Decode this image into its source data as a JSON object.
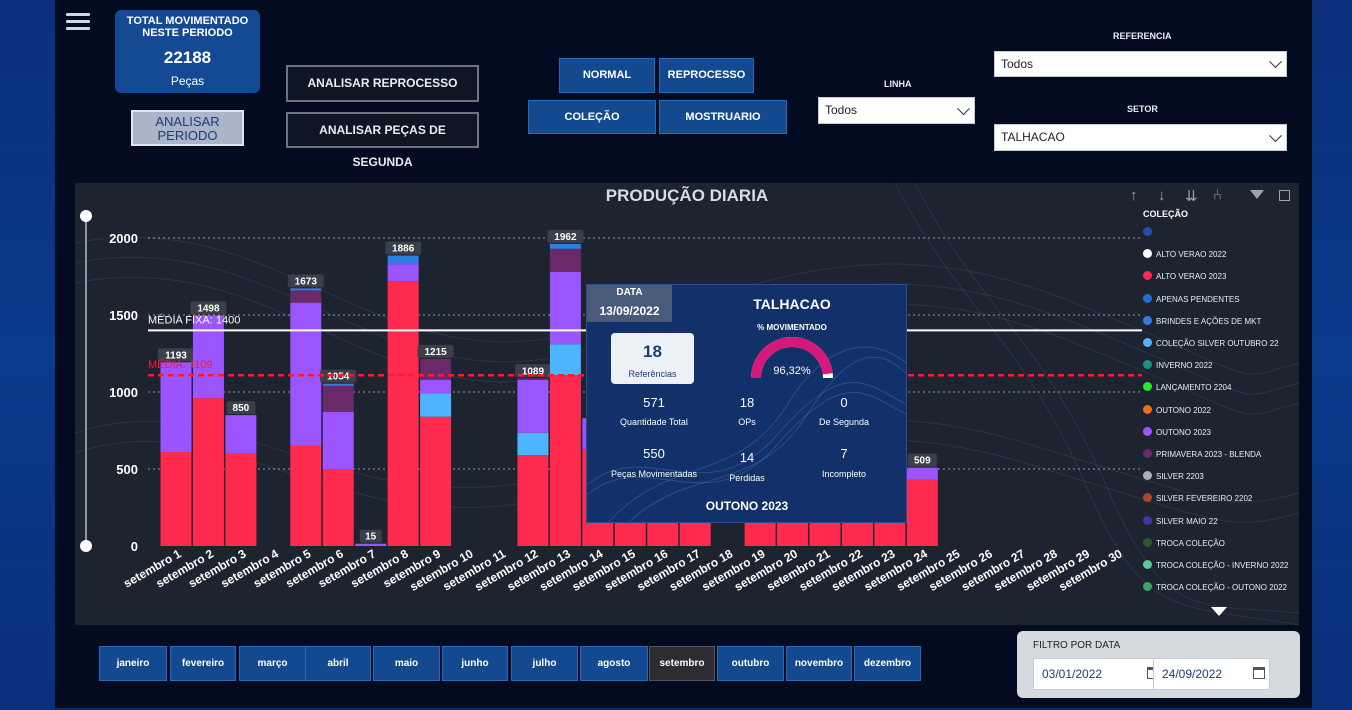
{
  "kpi": {
    "title": "TOTAL MOVIMENTADO NESTE PERIODO",
    "value": "22188",
    "unit": "Peças"
  },
  "buttons": {
    "analisar_periodo": "ANALISAR PERIODO",
    "analisar_reprocesso": "ANALISAR REPROCESSO",
    "analisar_segunda": "ANALISAR PEÇAS DE SEGUNDA",
    "normal": "NORMAL",
    "reprocesso": "REPROCESSO",
    "colecao": "COLEÇÃO",
    "mostruario": "MOSTRUARIO"
  },
  "filters": {
    "linha_label": "LINHA",
    "linha_value": "Todos",
    "referencia_label": "REFERENCIA",
    "referencia_value": "Todos",
    "setor_label": "SETOR",
    "setor_value": "TALHACAO"
  },
  "chart_title": "PRODUÇÃO DIARIA",
  "legend": {
    "title": "COLEÇÃO",
    "items": [
      {
        "label": "",
        "color": "#1f4fa8"
      },
      {
        "label": "ALTO VERAO 2022",
        "color": "#ffffff"
      },
      {
        "label": "ALTO VERAO 2023",
        "color": "#ff2a4d"
      },
      {
        "label": "APENAS PENDENTES",
        "color": "#1e6fd9"
      },
      {
        "label": "BRINDES E AÇÕES DE MKT",
        "color": "#2f7fe0"
      },
      {
        "label": "COLEÇÃO SILVER OUTUBRO 22",
        "color": "#4db5ff"
      },
      {
        "label": "INVERNO 2022",
        "color": "#1f8f80"
      },
      {
        "label": "LANÇAMENTO 2204",
        "color": "#29e82a"
      },
      {
        "label": "OUTONO 2022",
        "color": "#e8701e"
      },
      {
        "label": "OUTONO 2023",
        "color": "#9a55ff"
      },
      {
        "label": "PRIMAVERA 2023 - BLENDA",
        "color": "#6a2a6a"
      },
      {
        "label": "SILVER 2203",
        "color": "#a8b0bb"
      },
      {
        "label": "SILVER FEVEREIRO 2202",
        "color": "#b0452a"
      },
      {
        "label": "SILVER MAIO 22",
        "color": "#3a3aa0"
      },
      {
        "label": "TROCA COLEÇÃO",
        "color": "#2a5a2a"
      },
      {
        "label": "TROCA COLEÇÃO - INVERNO 2022",
        "color": "#5ac8a0"
      },
      {
        "label": "TROCA COLEÇÃO - OUTONO 2022",
        "color": "#3aa85a"
      }
    ]
  },
  "tooltip": {
    "data_label": "DATA",
    "date": "13/09/2022",
    "setor": "TALHACAO",
    "pct_label": "% MOVIMENTADO",
    "pct_value": "96,32%",
    "pct": 96.32,
    "ref_value": "18",
    "ref_label": "Referências",
    "qt_value": "571",
    "qt_label": "Quantidade Total",
    "ops_value": "18",
    "ops_label": "OPs",
    "seg_value": "0",
    "seg_label": "De Segunda",
    "mov_value": "550",
    "mov_label": "Peças Movimentadas",
    "perd_value": "14",
    "perd_label": "Perdidas",
    "inc_value": "7",
    "inc_label": "Incompleto",
    "colecao": "OUTONO 2023"
  },
  "months": [
    "janeiro",
    "fevereiro",
    "março",
    "abril",
    "maio",
    "junho",
    "julho",
    "agosto",
    "setembro",
    "outubro",
    "novembro",
    "dezembro"
  ],
  "selected_month": "setembro",
  "date_filter": {
    "label": "FILTRO POR DATA",
    "start": "03/01/2022",
    "end": "24/09/2022"
  },
  "chart_data": {
    "type": "bar",
    "title": "PRODUÇÃO DIARIA",
    "ylim": [
      0,
      2000
    ],
    "yticks": [
      "0",
      "500",
      "1000",
      "1500",
      "2000"
    ],
    "categories": [
      "setembro 1",
      "setembro 2",
      "setembro 3",
      "setembro 4",
      "setembro 5",
      "setembro 6",
      "setembro 7",
      "setembro 8",
      "setembro 9",
      "setembro 10",
      "setembro 11",
      "setembro 12",
      "setembro 13",
      "setembro 14",
      "setembro 15",
      "setembro 16",
      "setembro 17",
      "setembro 18",
      "setembro 19",
      "setembro 20",
      "setembro 21",
      "setembro 22",
      "setembro 23",
      "setembro 24",
      "setembro 25",
      "setembro 26",
      "setembro 27",
      "setembro 28",
      "setembro 29",
      "setembro 30"
    ],
    "bars": [
      {
        "day": 1,
        "total": "1193",
        "segs": [
          [
            610,
            "#ff2a4d"
          ],
          [
            583,
            "#9a55ff"
          ]
        ]
      },
      {
        "day": 2,
        "total": "1498",
        "segs": [
          [
            960,
            "#ff2a4d"
          ],
          [
            538,
            "#9a55ff"
          ]
        ]
      },
      {
        "day": 3,
        "total": "850",
        "segs": [
          [
            600,
            "#ff2a4d"
          ],
          [
            250,
            "#9a55ff"
          ]
        ]
      },
      {
        "day": 5,
        "total": "1673",
        "segs": [
          [
            650,
            "#ff2a4d"
          ],
          [
            930,
            "#9a55ff"
          ],
          [
            80,
            "#6a2a6a"
          ],
          [
            13,
            "#2f7fe0"
          ]
        ]
      },
      {
        "day": 6,
        "total": "1054",
        "segs": [
          [
            500,
            "#ff2a4d"
          ],
          [
            370,
            "#9a55ff"
          ],
          [
            170,
            "#6a2a6a"
          ],
          [
            14,
            "#2f7fe0"
          ]
        ]
      },
      {
        "day": 7,
        "total": "15",
        "segs": [
          [
            15,
            "#9a55ff"
          ]
        ]
      },
      {
        "day": 8,
        "total": "1886",
        "segs": [
          [
            1720,
            "#ff2a4d"
          ],
          [
            110,
            "#9a55ff"
          ],
          [
            56,
            "#2f7fe0"
          ]
        ]
      },
      {
        "day": 9,
        "total": "1215",
        "segs": [
          [
            840,
            "#ff2a4d"
          ],
          [
            150,
            "#4db5ff"
          ],
          [
            90,
            "#9a55ff"
          ],
          [
            135,
            "#6a2a6a"
          ]
        ]
      },
      {
        "day": 12,
        "total": "1089",
        "segs": [
          [
            590,
            "#ff2a4d"
          ],
          [
            145,
            "#4db5ff"
          ],
          [
            344,
            "#9a55ff"
          ],
          [
            10,
            "#6a2a6a"
          ]
        ]
      },
      {
        "day": 13,
        "total": "1962",
        "segs": [
          [
            1110,
            "#ff2a4d"
          ],
          [
            200,
            "#4db5ff"
          ],
          [
            470,
            "#9a55ff"
          ],
          [
            150,
            "#6a2a6a"
          ],
          [
            32,
            "#2f7fe0"
          ]
        ]
      },
      {
        "day": 14,
        "total": "",
        "segs": [
          [
            630,
            "#ff2a4d"
          ],
          [
            200,
            "#9a55ff"
          ]
        ]
      },
      {
        "day": 15,
        "total": "",
        "segs": [
          [
            500,
            "#ff2a4d"
          ]
        ]
      },
      {
        "day": 16,
        "total": "",
        "segs": [
          [
            500,
            "#ff2a4d"
          ]
        ]
      },
      {
        "day": 17,
        "total": "",
        "segs": [
          [
            500,
            "#ff2a4d"
          ]
        ]
      },
      {
        "day": 19,
        "total": "",
        "segs": [
          [
            500,
            "#ff2a4d"
          ]
        ]
      },
      {
        "day": 20,
        "total": "",
        "segs": [
          [
            500,
            "#ff2a4d"
          ]
        ]
      },
      {
        "day": 21,
        "total": "",
        "segs": [
          [
            500,
            "#ff2a4d"
          ]
        ]
      },
      {
        "day": 22,
        "total": "",
        "segs": [
          [
            500,
            "#ff2a4d"
          ]
        ]
      },
      {
        "day": 23,
        "total": "",
        "segs": [
          [
            500,
            "#ff2a4d"
          ]
        ]
      },
      {
        "day": 24,
        "total": "509",
        "segs": [
          [
            430,
            "#ff2a4d"
          ],
          [
            79,
            "#9a55ff"
          ]
        ]
      }
    ],
    "ref_lines": [
      {
        "label": "MÉDIA FIXA: 1400",
        "value": 1400,
        "color": "#ffffff",
        "dashed": false
      },
      {
        "label": "MÉDIA: 1109",
        "value": 1109,
        "color": "#ff1a2a",
        "dashed": true
      }
    ]
  }
}
